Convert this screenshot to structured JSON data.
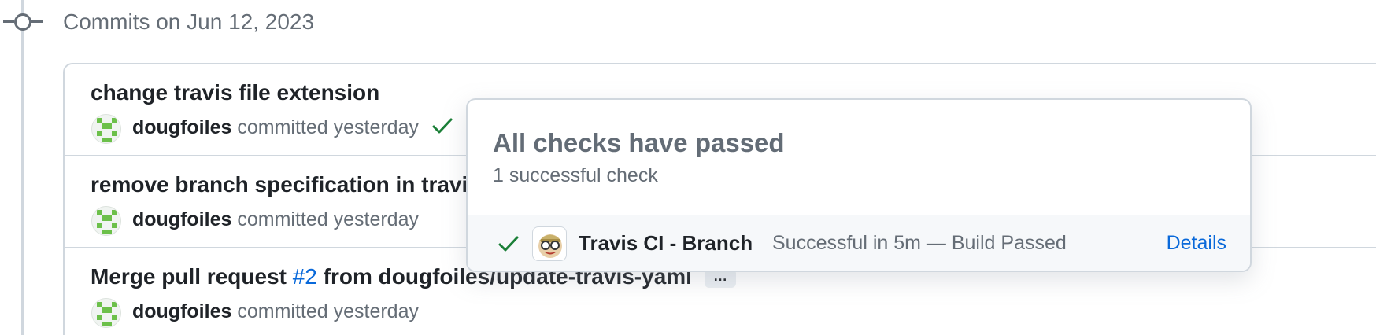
{
  "timeline": {
    "group_title": "Commits on Jun 12, 2023"
  },
  "commits": [
    {
      "title": "change travis file extension",
      "author": "dougfoiles",
      "meta": "committed yesterday",
      "status": "check-passed"
    },
    {
      "title": "remove branch specification in travi",
      "author": "dougfoiles",
      "meta": "committed yesterday"
    },
    {
      "title_prefix": "Merge pull request ",
      "pr_number": "#2",
      "title_suffix": " from dougfoiles/update-travis-yaml",
      "ellipsis": "…",
      "author": "dougfoiles",
      "meta": "committed yesterday"
    }
  ],
  "popover": {
    "title": "All checks have passed",
    "subtitle": "1 successful check",
    "checks": [
      {
        "icon": "check-icon",
        "app_icon": "travis-ci-icon",
        "name": "Travis CI - Branch",
        "status": "Successful in 5m — Build Passed",
        "details": "Details"
      }
    ]
  },
  "colors": {
    "success": "#1a7f37",
    "link": "#0969da",
    "muted": "#656d76",
    "border": "#d0d7de"
  }
}
